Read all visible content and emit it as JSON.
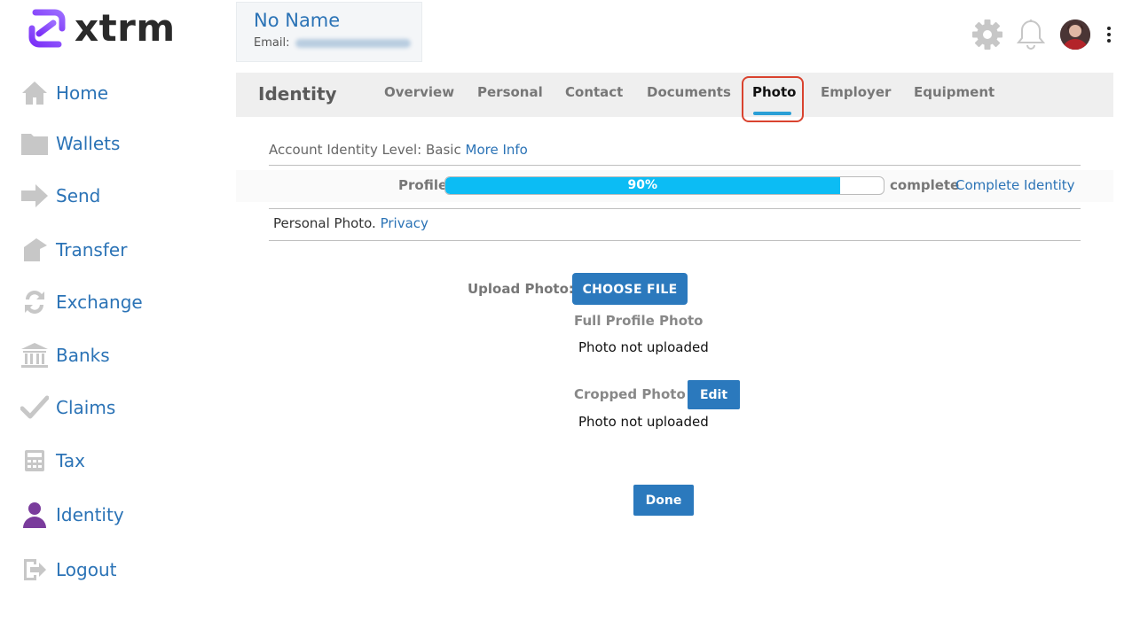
{
  "logo": {
    "text": "xtrm"
  },
  "sidebar": {
    "items": [
      {
        "label": "Home",
        "icon": "home-icon"
      },
      {
        "label": "Wallets",
        "icon": "folder-icon"
      },
      {
        "label": "Send",
        "icon": "send-arrow-icon"
      },
      {
        "label": "Transfer",
        "icon": "transfer-icon"
      },
      {
        "label": "Exchange",
        "icon": "exchange-icon"
      },
      {
        "label": "Banks",
        "icon": "bank-icon"
      },
      {
        "label": "Claims",
        "icon": "checkmark-icon"
      },
      {
        "label": "Tax",
        "icon": "calculator-icon"
      },
      {
        "label": "Identity",
        "icon": "person-icon"
      },
      {
        "label": "Logout",
        "icon": "logout-icon"
      }
    ]
  },
  "user": {
    "name": "No Name",
    "email_label": "Email:"
  },
  "tabs": {
    "title": "Identity",
    "items": [
      "Overview",
      "Personal",
      "Contact",
      "Documents",
      "Photo",
      "Employer",
      "Equipment"
    ],
    "active": "Photo"
  },
  "identity": {
    "level_text": "Account Identity Level: Basic",
    "more_info": "More Info",
    "profile_label": "Profile",
    "progress_percent": 90,
    "progress_text": "90%",
    "complete_text": "complete",
    "complete_link": "Complete Identity",
    "personal_photo_text": "Personal Photo.",
    "privacy_link": "Privacy"
  },
  "photo": {
    "upload_label": "Upload Photo:",
    "choose_file": "CHOOSE FILE",
    "full_label": "Full Profile Photo",
    "full_status": "Photo not uploaded",
    "cropped_label": "Cropped Photo",
    "edit_label": "Edit",
    "cropped_status": "Photo not uploaded",
    "done_label": "Done"
  },
  "colors": {
    "link": "#2b73b6",
    "progress": "#0cbcf4",
    "button": "#2b79bd",
    "highlight": "#d9432f",
    "identity_icon": "#7a3c9c"
  }
}
